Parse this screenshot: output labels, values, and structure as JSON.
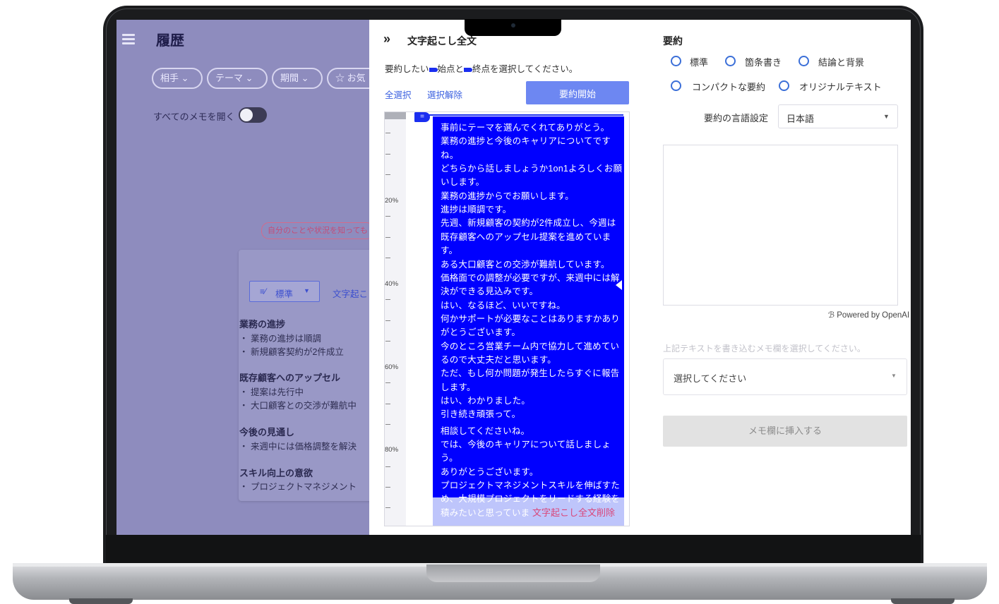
{
  "sidebar": {
    "title": "履歴",
    "filters": [
      "相手",
      "テーマ",
      "期間",
      "お気"
    ],
    "open_all_label": "すべてのメモを開く",
    "hint_chip": "自分のことや状況を知っても"
  },
  "card": {
    "mode_select": "標準",
    "mode_tab": "文字起こ",
    "sections": [
      {
        "heading": "業務の進捗",
        "items": [
          "・ 業務の進捗は順調",
          "・ 新規顧客契約が2件成立"
        ]
      },
      {
        "heading": "既存顧客へのアップセル",
        "items": [
          "・ 提案は先行中",
          "・ 大口顧客との交渉が難航中"
        ]
      },
      {
        "heading": "今後の見通し",
        "items": [
          "・ 来週中には価格調整を解決"
        ]
      },
      {
        "heading": "スキル向上の意欲",
        "items": [
          "・ プロジェクトマネジメント"
        ]
      }
    ]
  },
  "transcript": {
    "title": "文字起こし全文",
    "instruction_before": "要約したい",
    "instruction_mid": "始点と",
    "instruction_after": "終点を選択してください。",
    "select_all": "全選択",
    "deselect": "選択解除",
    "start_summary": "要約開始",
    "ruler_labels": [
      "20%",
      "40%",
      "60%",
      "80%"
    ],
    "lines": [
      "事前にテーマを選んでくれてありがとう。",
      "業務の進捗と今後のキャリアについてです",
      "ね。",
      "どちらから話しましょうか1on1よろしくお願",
      "いします。",
      "業務の進捗からでお願いします。",
      "進捗は順調です。",
      "先週、新規顧客の契約が2件成立し、今週は",
      "既存顧客へのアップセル提案を進めていま",
      "す。",
      "ある大口顧客との交渉が難航しています。",
      "価格面での調整が必要ですが、来週中には解",
      "決ができる見込みです。",
      "はい、なるほど、いいですね。",
      "何かサポートが必要なことはありますかあり",
      "がとうございます。",
      "今のところ営業チーム内で協力して進めてい",
      "るので大丈夫だと思います。",
      "ただ、もし何か問題が発生したらすぐに報告",
      "します。",
      "はい、わかりました。",
      "引き続き頑張って。",
      "相談してくださいね。",
      "では、今後のキャリアについて話しましょ",
      "う。",
      "ありがとうございます。",
      "プロジェクトマネジメントスキルを伸ばすた",
      "め、大規模プロジェクトをリードする経験を",
      "積みたいと思っていま"
    ],
    "delete_all": "文字起こし全文削除"
  },
  "summary": {
    "title": "要約",
    "options": [
      "標準",
      "箇条書き",
      "結論と背景",
      "コンパクトな要約",
      "オリジナルテキスト"
    ],
    "language_label": "要約の言語設定",
    "language_value": "日本語",
    "powered_by": "Powered by OpenAI",
    "memo_instruction": "上記テキストを書き込むメモ欄を選択してください。",
    "memo_placeholder": "選択してください",
    "insert_button": "メモ欄に挿入する"
  }
}
